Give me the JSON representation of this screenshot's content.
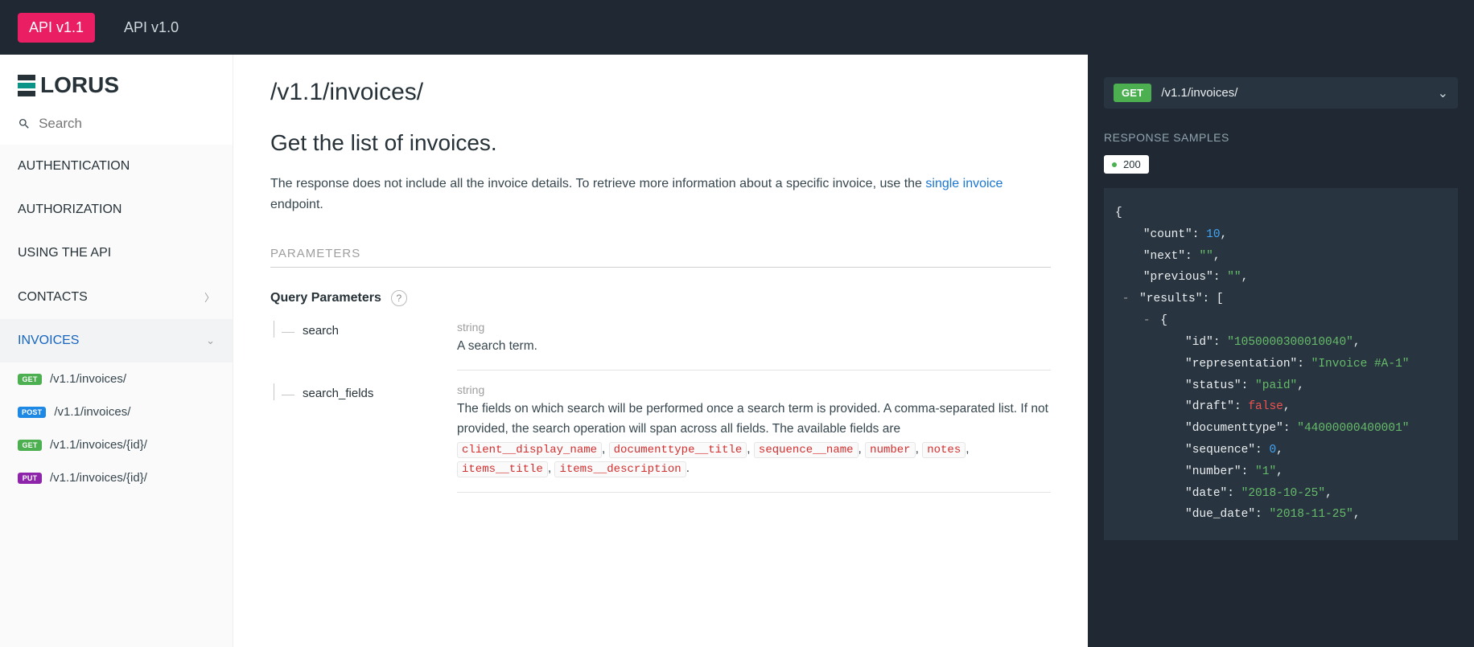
{
  "topbar": {
    "tabs": [
      {
        "label": "API v1.1",
        "active": true
      },
      {
        "label": "API v1.0",
        "active": false
      }
    ]
  },
  "brand": {
    "name": "LORUS"
  },
  "search": {
    "placeholder": "Search"
  },
  "sidebar": {
    "items": [
      {
        "label": "AUTHENTICATION"
      },
      {
        "label": "AUTHORIZATION"
      },
      {
        "label": "USING THE API"
      },
      {
        "label": "CONTACTS"
      },
      {
        "label": "INVOICES"
      }
    ],
    "sub": [
      {
        "method": "GET",
        "path": "/v1.1/invoices/"
      },
      {
        "method": "POST",
        "path": "/v1.1/invoices/"
      },
      {
        "method": "GET",
        "path": "/v1.1/invoices/{id}/"
      },
      {
        "method": "PUT",
        "path": "/v1.1/invoices/{id}/"
      }
    ]
  },
  "endpoint": {
    "title": "/v1.1/invoices/",
    "heading": "Get the list of invoices.",
    "desc_pre": "The response does not include all the invoice details. To retrieve more information about a specific invoice, use the ",
    "desc_link": "single invoice",
    "desc_post": " endpoint.",
    "params_header": "PARAMETERS",
    "qp_title": "Query Parameters"
  },
  "params": [
    {
      "name": "search",
      "type": "string",
      "desc": "A search term."
    },
    {
      "name": "search_fields",
      "type": "string",
      "desc": "The fields on which search will be performed once a search term is provided. A comma-separated list. If not provided, the search operation will span across all fields. The available fields are ",
      "codes": [
        "client__display_name",
        "documenttype__title",
        "sequence__name",
        "number",
        "notes",
        "items__title",
        "items__description"
      ]
    }
  ],
  "samples": {
    "method": "GET",
    "path": "/v1.1/invoices/",
    "rs_title": "RESPONSE SAMPLES",
    "status": "200",
    "json": {
      "count": 10,
      "next": "",
      "previous": "",
      "results": [
        {
          "id": "1050000300010040",
          "representation": "Invoice #A-1",
          "status": "paid",
          "draft": false,
          "documenttype": "44000000400001",
          "sequence": 0,
          "number": "1",
          "date": "2018-10-25",
          "due_date": "2018-11-25"
        }
      ]
    }
  }
}
